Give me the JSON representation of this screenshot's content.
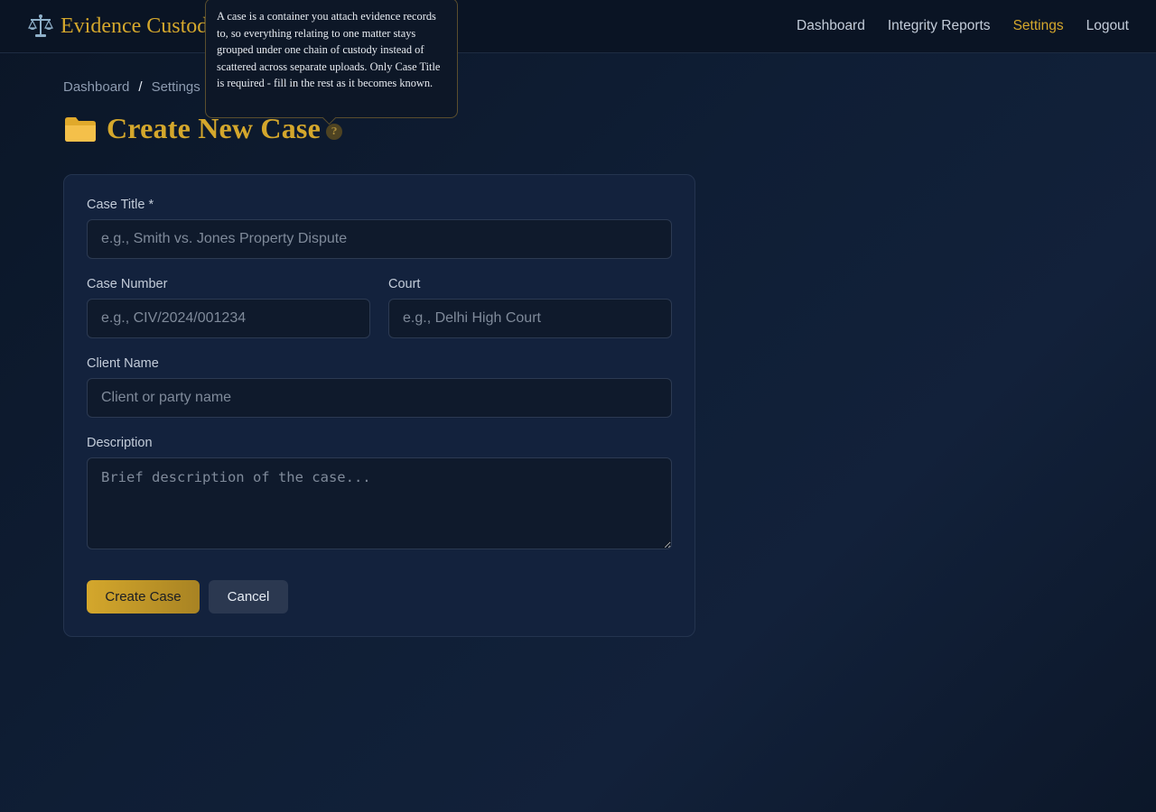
{
  "app": {
    "title": "Evidence Custody",
    "brand_color": "#d4a72c",
    "logo_icon": "scales-icon"
  },
  "nav": {
    "items": [
      {
        "label": "Dashboard",
        "active": false
      },
      {
        "label": "Integrity Reports",
        "active": false
      },
      {
        "label": "Settings",
        "active": true
      },
      {
        "label": "Logout",
        "active": false
      }
    ]
  },
  "breadcrumb": {
    "items": [
      "Dashboard",
      "Settings"
    ],
    "separator": "/"
  },
  "page": {
    "title": "Create New Case",
    "title_icon": "folder-icon",
    "help_glyph": "?",
    "help_tooltip": "A case is a container you attach evidence records to, so everything relating to one matter stays grouped under one chain of custody instead of scattered across separate uploads. Only Case Title is required - fill in the rest as it becomes known."
  },
  "form": {
    "case_title": {
      "label": "Case Title *",
      "placeholder": "e.g., Smith vs. Jones Property Dispute",
      "value": ""
    },
    "case_number": {
      "label": "Case Number",
      "placeholder": "e.g., CIV/2024/001234",
      "value": ""
    },
    "court": {
      "label": "Court",
      "placeholder": "e.g., Delhi High Court",
      "value": ""
    },
    "client_name": {
      "label": "Client Name",
      "placeholder": "Client or party name",
      "value": ""
    },
    "description": {
      "label": "Description",
      "placeholder": "Brief description of the case...",
      "value": ""
    },
    "submit_label": "Create Case",
    "cancel_label": "Cancel"
  }
}
